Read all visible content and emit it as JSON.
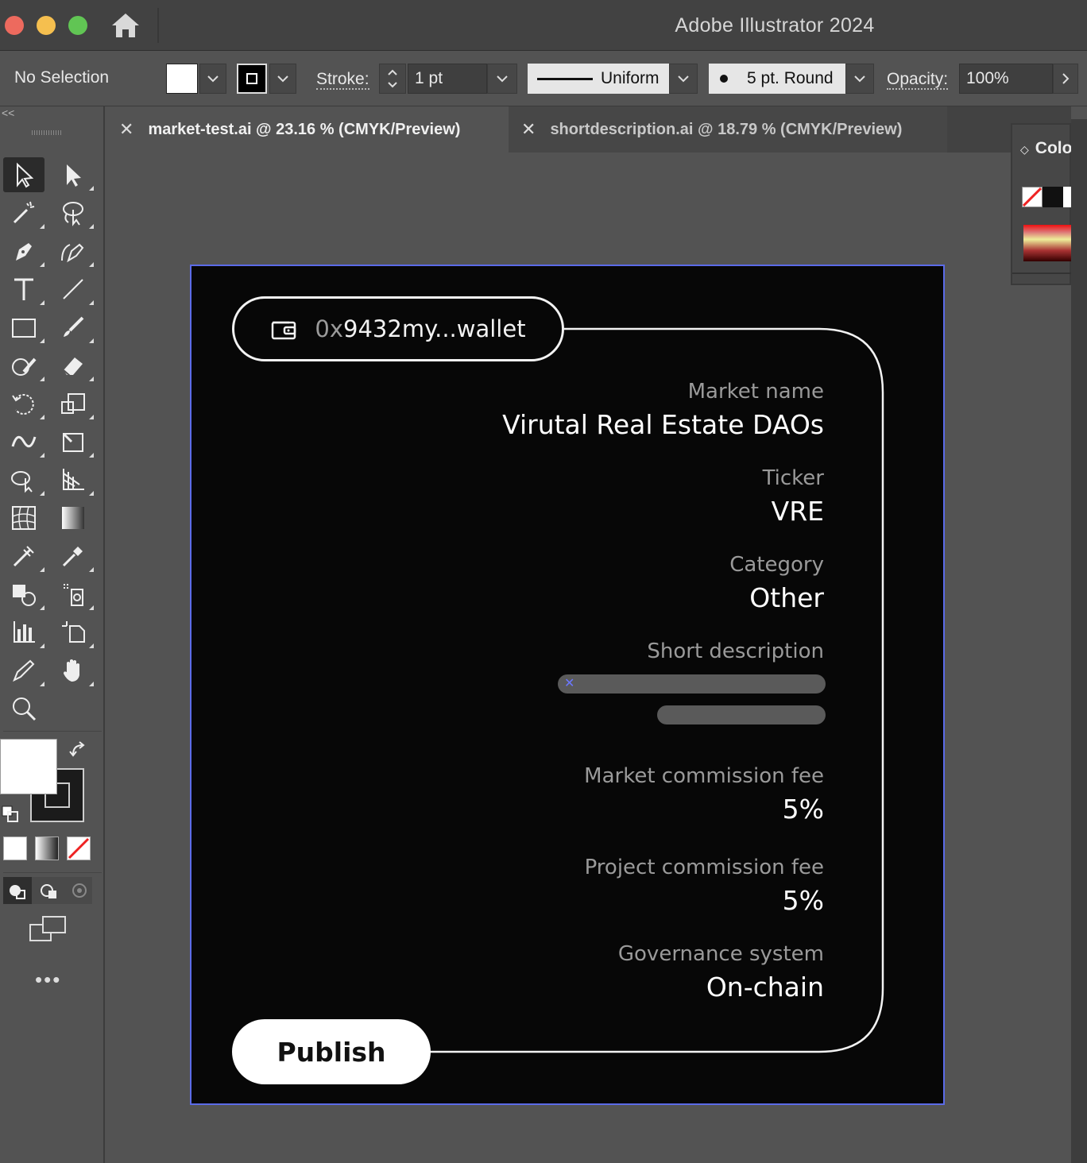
{
  "window": {
    "title": "Adobe Illustrator 2024"
  },
  "control_bar": {
    "selection_status": "No Selection",
    "stroke_label": "Stroke:",
    "stroke_weight": "1 pt",
    "stroke_profile": "Uniform",
    "brush": "5 pt. Round",
    "opacity_label": "Opacity:",
    "opacity_value": "100%",
    "fill_color": "#ffffff",
    "stroke_color": "#000000"
  },
  "tabs": [
    {
      "label": "market-test.ai @ 23.16 % (CMYK/Preview)",
      "active": true
    },
    {
      "label": "shortdescription.ai @ 18.79 % (CMYK/Preview)",
      "active": false
    }
  ],
  "right_panel": {
    "title": "Colo"
  },
  "artboard": {
    "wallet": {
      "prefix": "0x",
      "rest": "9432my...wallet"
    },
    "fields": [
      {
        "label": "Market name",
        "value": "Virutal Real Estate DAOs"
      },
      {
        "label": "Ticker",
        "value": "VRE"
      },
      {
        "label": "Category",
        "value": "Other"
      },
      {
        "label": "Short description",
        "value": ""
      },
      {
        "label": "Market commission fee",
        "value": "5%"
      },
      {
        "label": "Project commission fee",
        "value": "5%"
      },
      {
        "label": "Governance system",
        "value": "On-chain"
      }
    ],
    "publish_label": "Publish",
    "colors": {
      "background": "#070707",
      "foreground": "#f2f2f2",
      "label": "#9a9a9a",
      "placeholder": "#5a5a5a",
      "selection": "#5b6be8"
    }
  }
}
